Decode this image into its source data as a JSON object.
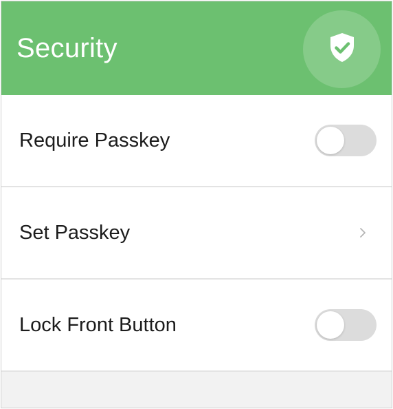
{
  "header": {
    "title": "Security",
    "icon": "shield-check-icon",
    "background_color": "#6cc070"
  },
  "settings": [
    {
      "label": "Require Passkey",
      "control": "toggle",
      "checked": false
    },
    {
      "label": "Set Passkey",
      "control": "chevron",
      "icon": "chevron-right-icon"
    },
    {
      "label": "Lock Front Button",
      "control": "toggle",
      "checked": false
    }
  ]
}
